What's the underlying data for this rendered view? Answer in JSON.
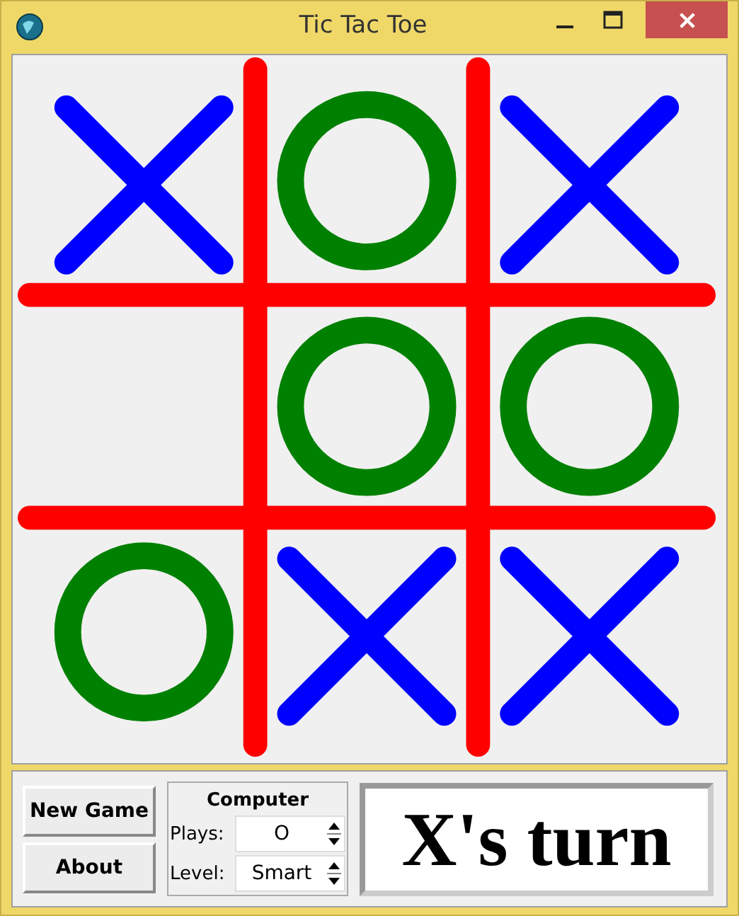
{
  "window": {
    "title": "Tic Tac Toe"
  },
  "board": {
    "cells": [
      {
        "kind": "x"
      },
      {
        "kind": "o"
      },
      {
        "kind": "x"
      },
      {
        "kind": "empty"
      },
      {
        "kind": "o"
      },
      {
        "kind": "o"
      },
      {
        "kind": "o"
      },
      {
        "kind": "x"
      },
      {
        "kind": "x"
      }
    ]
  },
  "buttons": [
    "New Game",
    "About"
  ],
  "computer": {
    "title": "Computer",
    "fields": [
      {
        "label": "Plays:",
        "value": "O"
      },
      {
        "label": "Level:",
        "value": "Smart"
      }
    ]
  },
  "status": "X's turn"
}
